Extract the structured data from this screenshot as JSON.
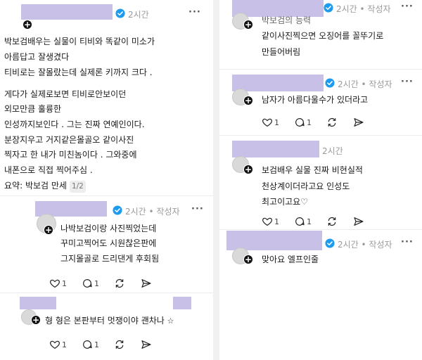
{
  "post": {
    "time": "2시간",
    "lines": [
      "박보검배우는 실물이 티비와 똑같이 미소가",
      "아름답고 잘생겼다",
      "티비로는 잘몰랐는데 실제론 키까지 크다 .",
      "",
      "게다가 실제로보면 티비로안보이던",
      "외모만큼 훌륭한",
      "인성까지보인다 . 그는 진짜 연예인이다.",
      "분장지우고 거지같은몰골오 같이사진",
      "찍자고 한 내가 미친놈이다 . 그와중에",
      "내폰으로 직접 찍어주심 .",
      "요약: 박보검 만세"
    ],
    "page_badge": "1/2"
  },
  "reply1": {
    "meta": "2시간 • 작성자",
    "lines": [
      "나박보검이랑 사진찍었는데",
      "꾸미고찍어도 시원찮은판에",
      "그지몰골로 드리댄게 후회됨"
    ],
    "like_count": "1",
    "comment_count": "1"
  },
  "reply2": {
    "text": "형 형은 본판부터 멋쟁이야 괜차나",
    "trailing_glyph": "☆",
    "like_count": "1",
    "comment_count": "1"
  },
  "r1": {
    "meta": "2시간 • 작성자",
    "lines": [
      "박보검의 능력",
      "같이사진찍으면 오징어를 꼴뚜기로",
      "만들어버림"
    ]
  },
  "r2": {
    "meta": "2시간 • 작성자",
    "text": "남자가 아름다울수가 있더라고",
    "like_count": "1",
    "comment_count": "1"
  },
  "r3": {
    "time": "2시간",
    "lines": [
      "보검배우 실물 진짜 비현실적",
      "천상계이더라고요 인성도",
      "최고이고요♡"
    ],
    "like_count": "1",
    "comment_count": "1"
  },
  "r4": {
    "meta": "2시간 • 작성자",
    "text": "맞아요 엘프인줄"
  },
  "icons": {
    "heart": "heart-icon",
    "comment": "comment-icon",
    "repost": "repost-icon",
    "share": "share-icon",
    "verified": "verified-badge-icon",
    "follow": "follow-plus-icon",
    "more": "more-options-icon"
  },
  "colors": {
    "verified": "#1d9bf0",
    "redaction": "#c8c0e6",
    "meta": "#9a9a9a"
  }
}
